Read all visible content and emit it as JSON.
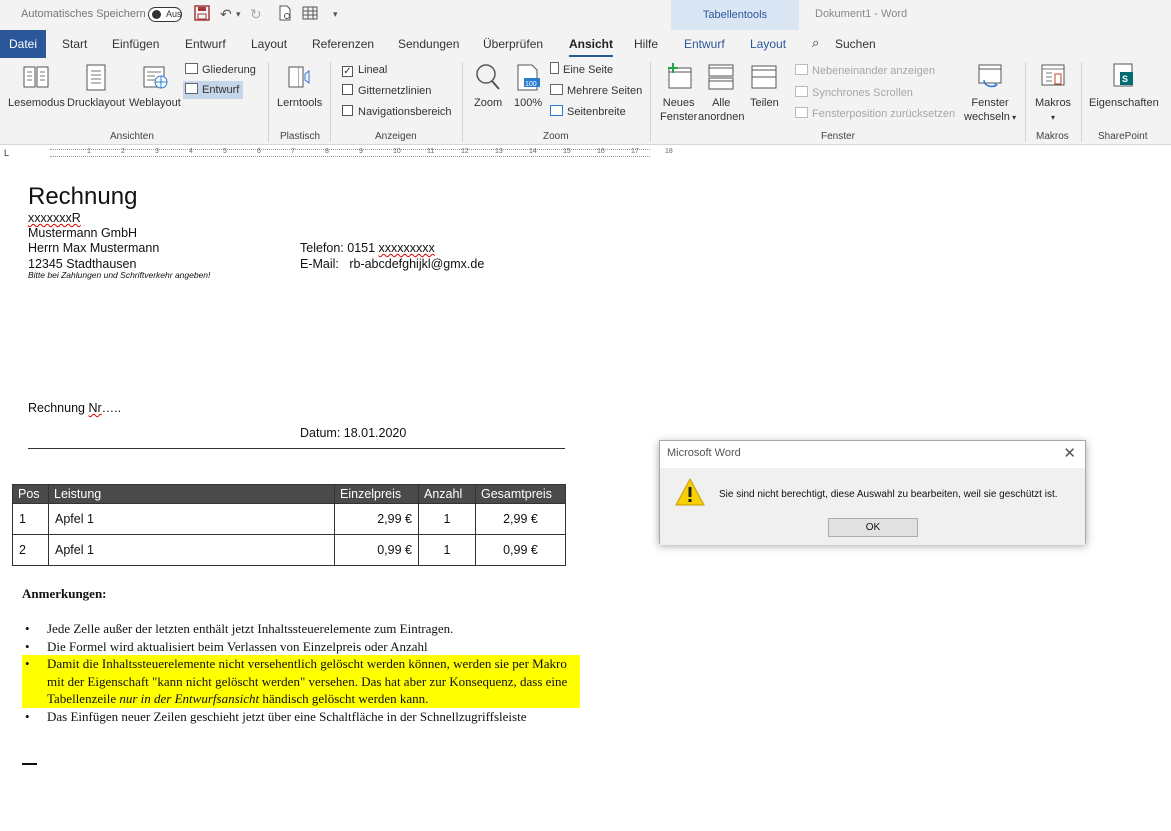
{
  "quick_access": {
    "autosave_label": "Automatisches Speichern",
    "autosave_state": "Aus"
  },
  "context_tab": "Tabellentools",
  "document_title": "Dokument1  -  Word",
  "tabs": {
    "file": "Datei",
    "start": "Start",
    "insert": "Einfügen",
    "design": "Entwurf",
    "layout": "Layout",
    "references": "Referenzen",
    "mailings": "Sendungen",
    "review": "Überprüfen",
    "view": "Ansicht",
    "help": "Hilfe",
    "table_design": "Entwurf",
    "table_layout": "Layout",
    "search": "Suchen"
  },
  "ribbon": {
    "views": {
      "label": "Ansichten",
      "read_mode": "Lesemodus",
      "print_layout": "Drucklayout",
      "web_layout": "Weblayout",
      "outline": "Gliederung",
      "draft": "Entwurf"
    },
    "immersive": {
      "label": "Plastisch",
      "learning_tools": "Lerntools"
    },
    "show": {
      "label": "Anzeigen",
      "ruler": "Lineal",
      "ruler_checked": true,
      "gridlines": "Gitternetzlinien",
      "navigation": "Navigationsbereich"
    },
    "zoom": {
      "label": "Zoom",
      "zoom": "Zoom",
      "hundred": "100%",
      "one_page": "Eine Seite",
      "multiple_pages": "Mehrere Seiten",
      "page_width": "Seitenbreite"
    },
    "window": {
      "label": "Fenster",
      "new_window_1": "Neues",
      "new_window_2": "Fenster",
      "arrange_all_1": "Alle",
      "arrange_all_2": "anordnen",
      "split": "Teilen",
      "side_by_side": "Nebeneinander anzeigen",
      "sync_scroll": "Synchrones Scrollen",
      "reset_position": "Fensterposition zurücksetzen",
      "switch_1": "Fenster",
      "switch_2": "wechseln"
    },
    "macros": {
      "label": "Makros",
      "macros": "Makros"
    },
    "sharepoint": {
      "label": "SharePoint",
      "properties": "Eigenschaften"
    }
  },
  "ruler_numbers": [
    "1",
    "2",
    "3",
    "4",
    "5",
    "6",
    "7",
    "8",
    "9",
    "10",
    "11",
    "12",
    "13",
    "14",
    "15",
    "16",
    "17",
    "18"
  ],
  "document": {
    "sender_code": "xxxxxxxR",
    "company": "Mustermann GmbH",
    "person": "Herrn Max Mustermann",
    "city": "12345 Stadthausen",
    "phone_label": "Telefon: 0151 ",
    "phone_value": "xxxxxxxxx",
    "email_label": "E-Mail:",
    "email_value": "rb-abcdefghijkl@gmx.de",
    "heading": "Rechnung",
    "invoice_no_1": "Rechnung ",
    "invoice_no_2": "Nr",
    "invoice_no_3": "…..",
    "hint": "Bitte bei Zahlungen und Schriftverkehr angeben!",
    "date": "Datum: 18.01.2020",
    "table": {
      "headers": [
        "Pos",
        "Leistung",
        "Einzelpreis",
        "Anzahl",
        "Gesamtpreis"
      ],
      "rows": [
        [
          "1",
          "Apfel 1",
          "2,99 €",
          "1",
          "2,99 €"
        ],
        [
          "2",
          "Apfel 1",
          "0,99 €",
          "1",
          "0,99 €"
        ]
      ]
    },
    "remarks_title": "Anmerkungen:",
    "remarks": [
      "Jede Zelle außer der letzten enthält jetzt Inhaltssteuerelemente zum Eintragen.",
      "Die Formel wird aktualisiert beim Verlassen von Einzelpreis oder Anzahl",
      "Damit die Inhaltssteuerelemente nicht versehentlich gelöscht werden können, werden sie per Makro mit der Eigenschaft \"kann nicht gelöscht werden\" versehen. Das hat aber zur Konsequenz, dass eine Tabellenzeile ",
      "nur in der Entwurfsansicht",
      " händisch gelöscht werden kann.",
      "Das Einfügen neuer Zeilen geschieht jetzt über eine Schaltfläche in der Schnellzugriffsleiste"
    ]
  },
  "dialog": {
    "title": "Microsoft Word",
    "message": "Sie sind nicht berechtigt, diese Auswahl zu bearbeiten, weil sie geschützt ist.",
    "ok": "OK"
  }
}
